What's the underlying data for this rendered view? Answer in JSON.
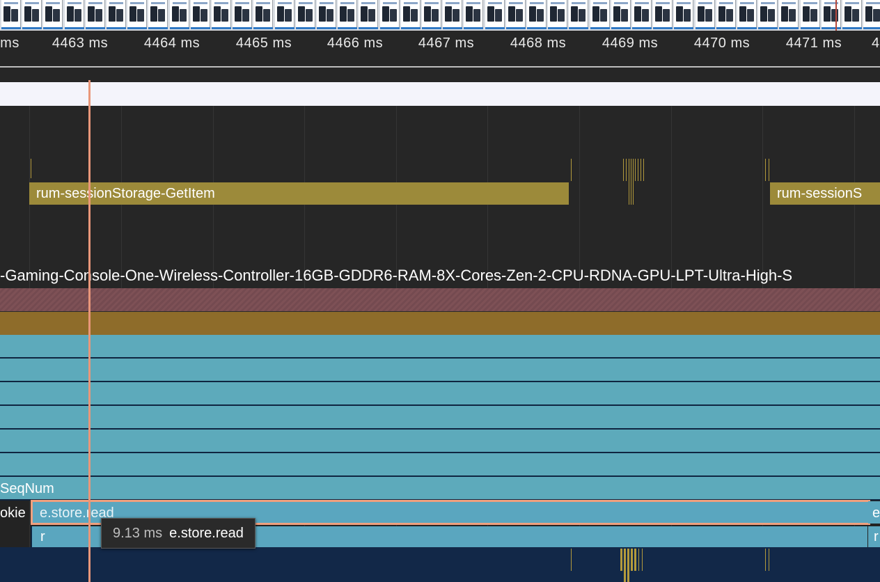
{
  "ruler": {
    "ticks": [
      "ms",
      "4463 ms",
      "4464 ms",
      "4465 ms",
      "4466 ms",
      "4467 ms",
      "4468 ms",
      "4469 ms",
      "4470 ms",
      "4471 ms",
      "4"
    ]
  },
  "timings": {
    "slice_left": "rum-sessionStorage-GetItem",
    "slice_right": "rum-sessionS"
  },
  "flame": {
    "url_label": "-Gaming-Console-One-Wireless-Controller-16GB-GDDR6-RAM-8X-Cores-Zen-2-CPU-RDNA-GPU-LPT-Ultra-High-S",
    "seqnum_label": "SeqNum",
    "cookie_label": "okie",
    "store_read_label": "e.store.read",
    "right_e": "e",
    "r_label": "r",
    "right_r": "r"
  },
  "tooltip": {
    "duration": "9.13 ms",
    "name": "e.store.read"
  },
  "colors": {
    "selection_outline": "#f0a07e",
    "timing_slice": "#9c8a3a",
    "flame_teal": "#5daabb",
    "cursor": "#e9977a"
  }
}
